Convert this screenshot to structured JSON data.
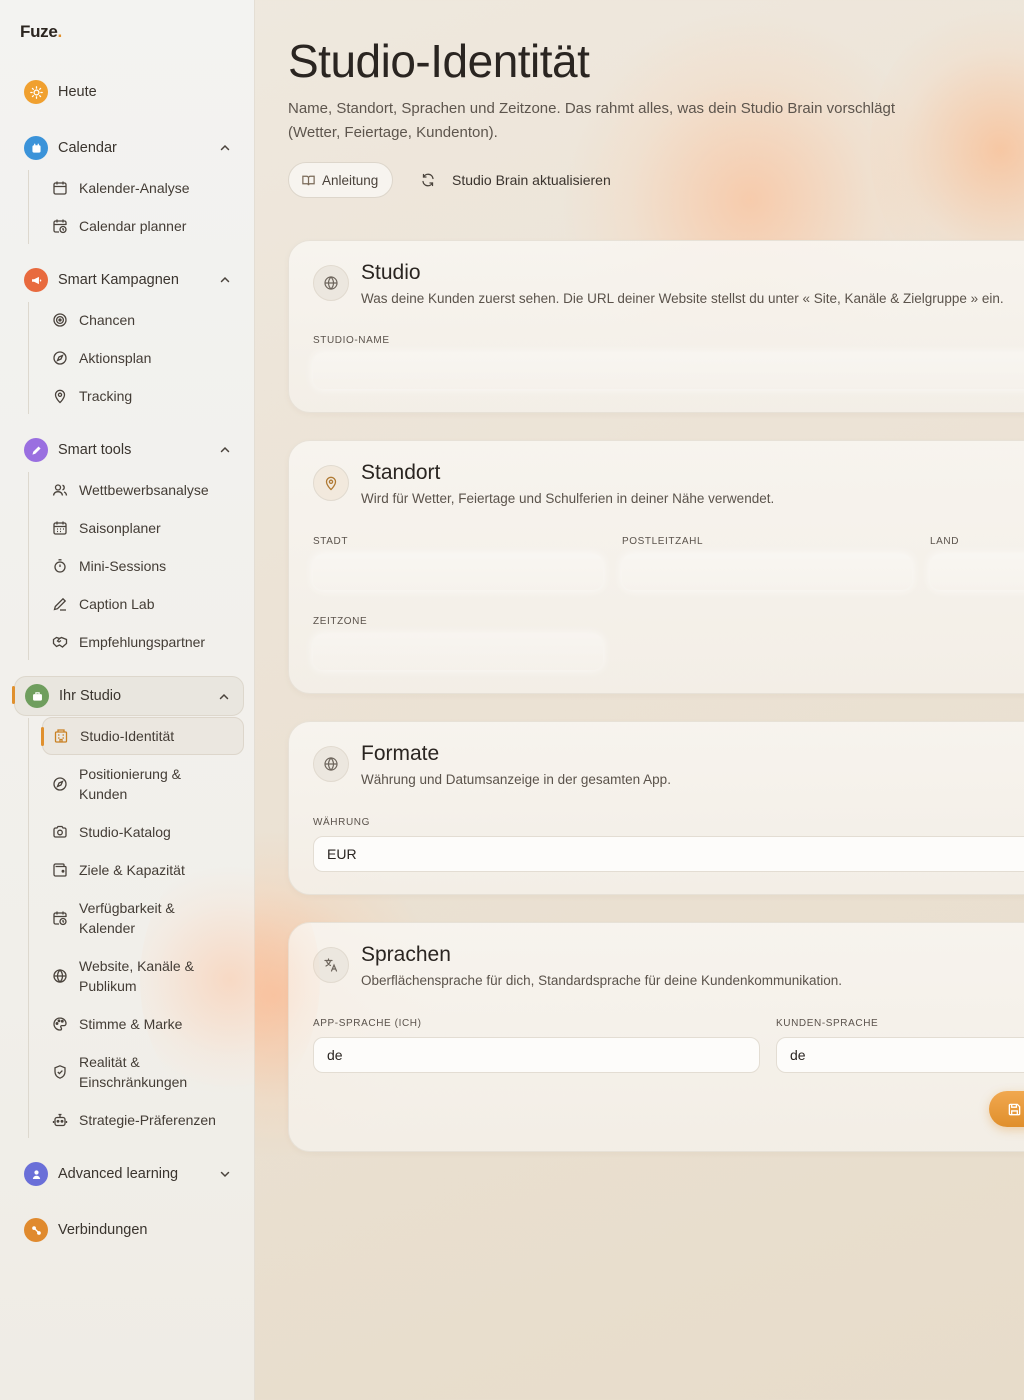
{
  "brand": {
    "name": "Fuze",
    "dot": "."
  },
  "sidebar": {
    "today": "Heute",
    "calendar": {
      "label": "Calendar",
      "items": [
        "Kalender-Analyse",
        "Calendar planner"
      ]
    },
    "campaigns": {
      "label": "Smart Kampagnen",
      "items": [
        "Chancen",
        "Aktionsplan",
        "Tracking"
      ]
    },
    "tools": {
      "label": "Smart tools",
      "items": [
        "Wettbewerbsanalyse",
        "Saisonplaner",
        "Mini-Sessions",
        "Caption Lab",
        "Empfehlungspartner"
      ]
    },
    "studio": {
      "label": "Ihr Studio",
      "items": [
        "Studio-Identität",
        "Positionierung & Kunden",
        "Studio-Katalog",
        "Ziele & Kapazität",
        "Verfügbarkeit & Kalender",
        "Website, Kanäle & Publikum",
        "Stimme & Marke",
        "Realität & Einschränkungen",
        "Strategie-Präferenzen"
      ]
    },
    "learning": "Advanced learning",
    "connections": "Verbindungen"
  },
  "page": {
    "title": "Studio-Identität",
    "subtitle": "Name, Standort, Sprachen und Zeitzone. Das rahmt alles, was dein Studio Brain vorschlägt (Wetter, Feiertage, Kundenton).",
    "guide_label": "Anleitung",
    "refresh_label": "Studio Brain aktualisieren"
  },
  "cards": {
    "studio": {
      "title": "Studio",
      "subtitle": "Was deine Kunden zuerst sehen. Die URL deiner Website stellst du unter « Site, Kanäle & Zielgruppe » ein.",
      "name_label": "Studio-Name"
    },
    "location": {
      "title": "Standort",
      "subtitle": "Wird für Wetter, Feiertage und Schulferien in deiner Nähe verwendet.",
      "city_label": "Stadt",
      "zip_label": "Postleitzahl",
      "country_label": "Land",
      "timezone_label": "Zeitzone"
    },
    "formats": {
      "title": "Formate",
      "subtitle": "Währung und Datumsanzeige in der gesamten App.",
      "currency_label": "Währung",
      "currency_value": "EUR"
    },
    "languages": {
      "title": "Sprachen",
      "subtitle": "Oberflächensprache für dich, Standardsprache für deine Kundenkommunikation.",
      "app_lang_label": "App-Sprache (ich)",
      "app_lang_value": "de",
      "client_lang_label": "Kunden-Sprache",
      "client_lang_value": "de"
    }
  },
  "colors": {
    "accent": "#e0902e",
    "calendar": "#3b93d9",
    "campaigns": "#e86a3e",
    "tools": "#9a6fe0",
    "studio": "#6f9e5e",
    "learning": "#6a6fd8",
    "connections": "#e08a2e"
  }
}
